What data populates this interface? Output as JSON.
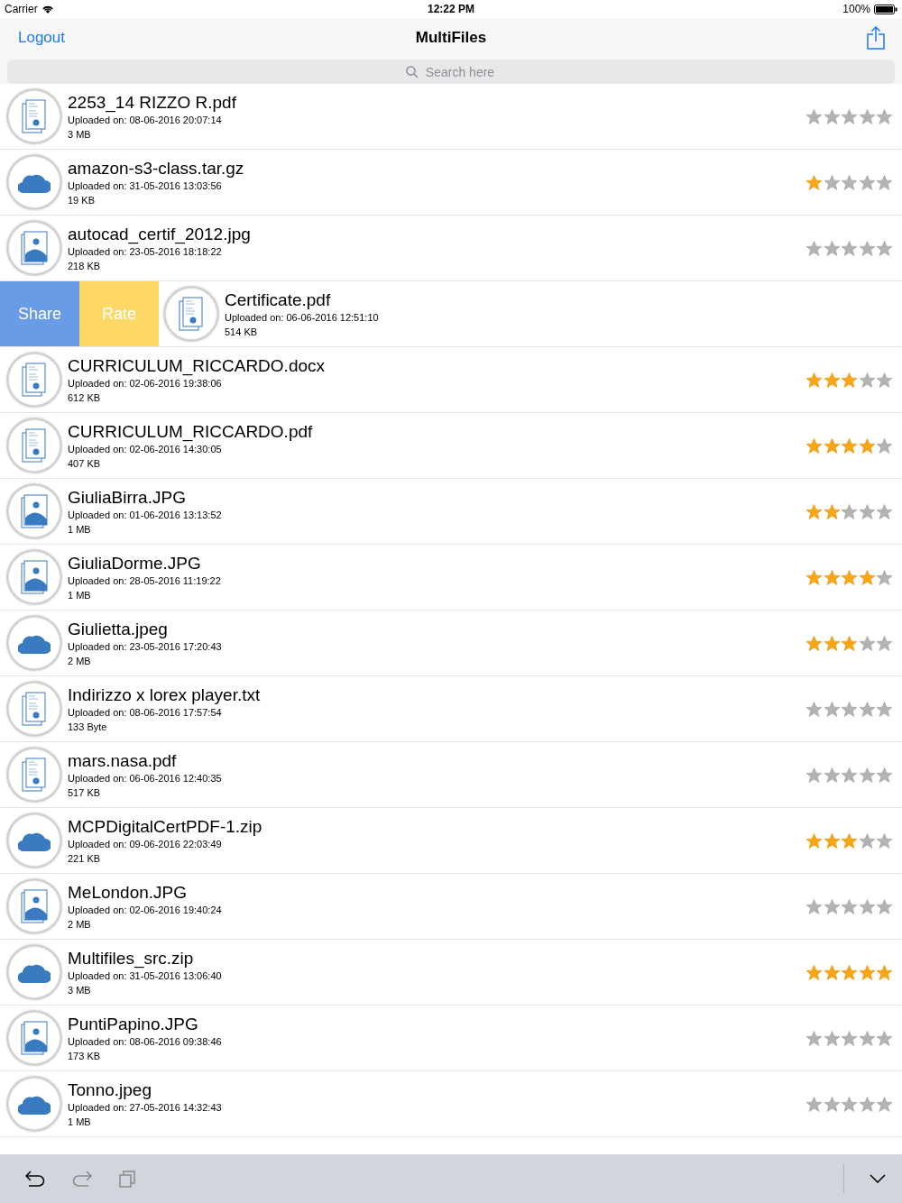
{
  "status_bar": {
    "carrier": "Carrier",
    "time": "12:22 PM",
    "battery": "100%"
  },
  "nav": {
    "left": "Logout",
    "title": "MultiFiles"
  },
  "search": {
    "placeholder": "Search here"
  },
  "rows": [
    {
      "kind": "document",
      "name": "2253_14 RIZZO R.pdf",
      "uploaded": "Uploaded on: 08-06-2016 20:07:14",
      "size": "3 MB",
      "stars": 0
    },
    {
      "kind": "cloud",
      "name": "amazon-s3-class.tar.gz",
      "uploaded": "Uploaded on: 31-05-2016 13:03:56",
      "size": "19 KB",
      "stars": 1
    },
    {
      "kind": "image",
      "name": "autocad_certif_2012.jpg",
      "uploaded": "Uploaded on: 23-05-2016 18:18:22",
      "size": "218 KB",
      "stars": 0
    },
    {
      "kind": "document",
      "name": "Certificate.pdf",
      "uploaded": "Uploaded on: 06-06-2016 12:51:10",
      "size": "514 KB",
      "actions": [
        {
          "kind": "share",
          "label": "Share"
        },
        {
          "kind": "rate",
          "label": "Rate"
        }
      ]
    },
    {
      "kind": "document",
      "name": "CURRICULUM_RICCARDO.docx",
      "uploaded": "Uploaded on: 02-06-2016 19:38:06",
      "size": "612 KB",
      "stars": 3
    },
    {
      "kind": "document",
      "name": "CURRICULUM_RICCARDO.pdf",
      "uploaded": "Uploaded on: 02-06-2016 14:30:05",
      "size": "407 KB",
      "stars": 4
    },
    {
      "kind": "image",
      "name": "GiuliaBirra.JPG",
      "uploaded": "Uploaded on: 01-06-2016 13:13:52",
      "size": "1 MB",
      "stars": 2
    },
    {
      "kind": "image",
      "name": "GiuliaDorme.JPG",
      "uploaded": "Uploaded on: 28-05-2016 11:19:22",
      "size": "1 MB",
      "stars": 4
    },
    {
      "kind": "cloud",
      "name": "Giulietta.jpeg",
      "uploaded": "Uploaded on: 23-05-2016 17:20:43",
      "size": "2 MB",
      "stars": 3
    },
    {
      "kind": "document",
      "name": "Indirizzo x lorex player.txt",
      "uploaded": "Uploaded on: 08-06-2016 17:57:54",
      "size": "133 Byte",
      "stars": 0
    },
    {
      "kind": "document",
      "name": "mars.nasa.pdf",
      "uploaded": "Uploaded on: 06-06-2016 12:40:35",
      "size": "517 KB",
      "stars": 0
    },
    {
      "kind": "cloud",
      "name": "MCPDigitalCertPDF-1.zip",
      "uploaded": "Uploaded on: 09-06-2016 22:03:49",
      "size": "221 KB",
      "stars": 3
    },
    {
      "kind": "image",
      "name": "MeLondon.JPG",
      "uploaded": "Uploaded on: 02-06-2016 19:40:24",
      "size": "2 MB",
      "stars": 0
    },
    {
      "kind": "cloud",
      "name": "Multifiles_src.zip",
      "uploaded": "Uploaded on: 31-05-2016 13:06:40",
      "size": "3 MB",
      "stars": 5
    },
    {
      "kind": "image",
      "name": "PuntiPapino.JPG",
      "uploaded": "Uploaded on: 08-06-2016 09:38:46",
      "size": "173 KB",
      "stars": 0
    },
    {
      "kind": "cloud",
      "name": "Tonno.jpeg",
      "uploaded": "Uploaded on: 27-05-2016 14:32:43",
      "size": "1 MB",
      "stars": 0
    }
  ],
  "keyboard_toolbar": [
    {
      "kind": "undo",
      "disabled": false
    },
    {
      "kind": "redo",
      "disabled": true
    },
    {
      "kind": "paste",
      "disabled": true
    },
    {
      "kind": "dismiss",
      "disabled": false
    }
  ]
}
